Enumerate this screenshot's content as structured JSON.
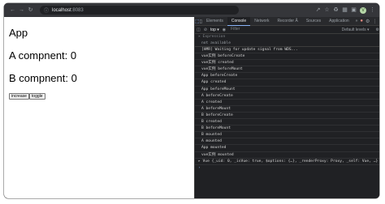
{
  "browser": {
    "url_host": "localhost",
    "url_port": ":8083",
    "back_icon": "arrow-left",
    "forward_icon": "arrow-right",
    "reload_icon": "reload",
    "avatar_letter": "V"
  },
  "page": {
    "title": "App",
    "a_count_text": "A compnent: 0",
    "b_count_text": "B compnent: 0",
    "increase_label": "increase",
    "toggle_label": "toggle"
  },
  "devtools": {
    "tabs": [
      "Elements",
      "Console",
      "Network",
      "Recorder Å",
      "Sources",
      "Application",
      "»"
    ],
    "active_tab": "Console",
    "context": "top ▾",
    "filter_placeholder": "Filter",
    "levels": "Default levels ▾",
    "expression_label": "Expression",
    "expression_value": "not available",
    "logs": [
      "[HMR] Waiting for update signal from WDS...",
      "vue实例 beforeCreate",
      "vue实例 created",
      "vue实例 beforeMount",
      "App beforeCreate",
      "App created",
      "App beforeMount",
      "A beforeCreate",
      "A created",
      "A beforeMount",
      "B beforeCreate",
      "B created",
      "B beforeMount",
      "B mounted",
      "A mounted",
      "App mounted",
      "vue实例 mounted"
    ],
    "object_line": "▸ Vue {_uid: 0, _isVue: true, $options: {…}, _renderProxy: Proxy, _self: Vue, …}"
  }
}
